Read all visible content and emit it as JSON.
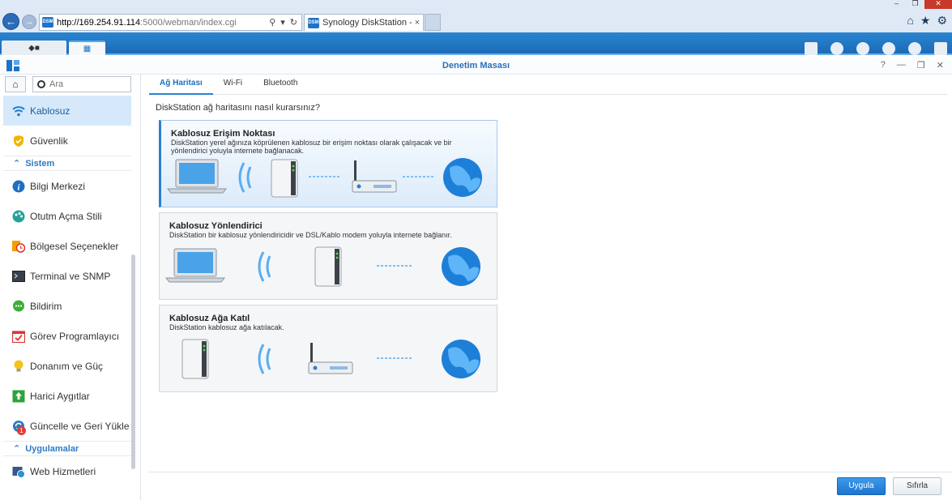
{
  "browser": {
    "url_host": "http://169.254.91.114",
    "url_path": ":5000/webman/index.cgi",
    "favicon_text": "DSM",
    "tab_title": "Synology DiskStation - Disk...",
    "tab_close": "×",
    "win_minimize": "‒",
    "win_restore": "❐",
    "win_close": "✕"
  },
  "window": {
    "title": "Denetim Masası",
    "controls": [
      "?",
      "—",
      "❐",
      "✕"
    ]
  },
  "sidebar": {
    "search_placeholder": "Ara",
    "items": [
      {
        "label": "Kablosuz",
        "icon": "wifi-icon",
        "active": true
      },
      {
        "label": "Güvenlik",
        "icon": "shield-icon"
      },
      {
        "group": "Sistem"
      },
      {
        "label": "Bilgi Merkezi",
        "icon": "info-icon"
      },
      {
        "label": "Otutm Açma Stili",
        "icon": "palette-icon"
      },
      {
        "label": "Bölgesel Seçenekler",
        "icon": "clock-icon"
      },
      {
        "label": "Terminal ve SNMP",
        "icon": "terminal-icon"
      },
      {
        "label": "Bildirim",
        "icon": "chat-icon"
      },
      {
        "label": "Görev Programlayıcı",
        "icon": "calendar-icon"
      },
      {
        "label": "Donanım ve Güç",
        "icon": "bulb-icon"
      },
      {
        "label": "Harici Aygıtlar",
        "icon": "upload-icon"
      },
      {
        "label": "Güncelle ve Geri Yükle",
        "icon": "update-icon",
        "badge": "1"
      },
      {
        "group": "Uygulamalar"
      },
      {
        "label": "Web Hizmetleri",
        "icon": "web-icon"
      }
    ]
  },
  "tabs": [
    "Ağ Haritası",
    "Wi-Fi",
    "Bluetooth"
  ],
  "question": "DiskStation ağ haritasını nasıl kurarsınız?",
  "options": [
    {
      "title": "Kablosuz Erişim Noktası",
      "desc": "DiskStation yerel ağınıza köprülenen kablosuz bir erişim noktası olarak çalışacak ve bir yönlendirici yoluyla internete bağlanacak."
    },
    {
      "title": "Kablosuz Yönlendirici",
      "desc": "DiskStation bir kablosuz yönlendiricidir ve DSL/Kablo modem yoluyla internete bağlanır."
    },
    {
      "title": "Kablosuz Ağa Katıl",
      "desc": "DiskStation kablosuz ağa katılacak."
    }
  ],
  "buttons": {
    "apply": "Uygula",
    "reset": "Sıfırla"
  },
  "colors": {
    "accent": "#2b7fd4",
    "taskbar": "#1c6bb8"
  }
}
